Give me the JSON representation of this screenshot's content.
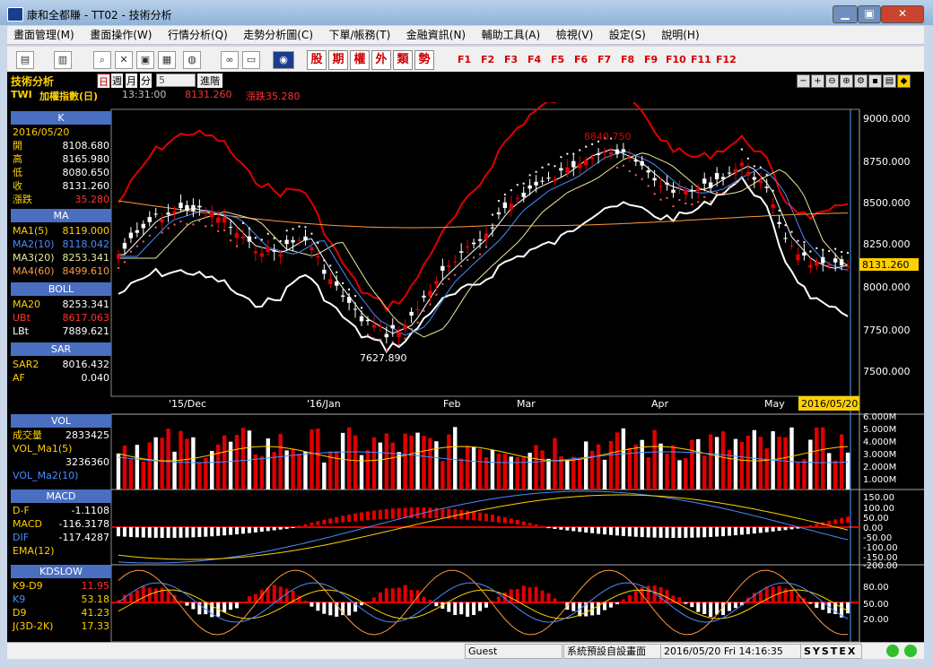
{
  "window": {
    "title": "康和全都賺 - TT02 - 技術分析",
    "minimize": "▁",
    "maximize": "▣",
    "close": "✕"
  },
  "menu": [
    "畫面管理(M)",
    "畫面操作(W)",
    "行情分析(Q)",
    "走勢分析圖(C)",
    "下單/帳務(T)",
    "金融資訊(N)",
    "輔助工具(A)",
    "檢視(V)",
    "設定(S)",
    "說明(H)"
  ],
  "toolbar": {
    "red_buttons": [
      "股",
      "期",
      "權",
      "外",
      "類",
      "勢"
    ],
    "fkeys": [
      "F1",
      "F2",
      "F3",
      "F4",
      "F5",
      "F6",
      "F7",
      "F8",
      "F9",
      "F10",
      "F11",
      "F12"
    ]
  },
  "chart_header": {
    "title": "技術分析",
    "periods": [
      "日",
      "週",
      "月",
      "分"
    ],
    "period_value": "5",
    "advanced": "進階",
    "symbol": "TWI",
    "name": "加權指數(日)",
    "time": "13:31:00",
    "price": "8131.260",
    "change": "漲跌35.280"
  },
  "left_panel": {
    "k": {
      "header": "K",
      "date": "2016/05/20",
      "rows": [
        {
          "label": "開",
          "value": "8108.680"
        },
        {
          "label": "高",
          "value": "8165.980"
        },
        {
          "label": "低",
          "value": "8080.650"
        },
        {
          "label": "收",
          "value": "8131.260"
        },
        {
          "label": "漲跌",
          "value": "35.280"
        }
      ]
    },
    "ma": {
      "header": "MA",
      "rows": [
        {
          "label": "MA1(5)",
          "value": "8119.000"
        },
        {
          "label": "MA2(10)",
          "value": "8118.042"
        },
        {
          "label": "MA3(20)",
          "value": "8253.341"
        },
        {
          "label": "MA4(60)",
          "value": "8499.610"
        }
      ]
    },
    "boll": {
      "header": "BOLL",
      "rows": [
        {
          "label": "MA20",
          "value": "8253.341"
        },
        {
          "label": "UBt",
          "value": "8617.063"
        },
        {
          "label": "LBt",
          "value": "7889.621"
        }
      ]
    },
    "sar": {
      "header": "SAR",
      "rows": [
        {
          "label": "SAR2",
          "value": "8016.432"
        },
        {
          "label": "AF",
          "value": "0.040"
        }
      ]
    },
    "vol": {
      "header": "VOL",
      "rows": [
        {
          "label": "成交量",
          "value": "2833425"
        },
        {
          "label": "VOL_Ma1(5)",
          "value": ""
        },
        {
          "label": "",
          "value": "3236360"
        },
        {
          "label": "VOL_Ma2(10)",
          "value": ""
        }
      ]
    },
    "macd": {
      "header": "MACD",
      "rows": [
        {
          "label": "D-F",
          "value": "-1.1108"
        },
        {
          "label": "MACD",
          "value": "-116.3178"
        },
        {
          "label": "DIF",
          "value": "-117.4287"
        },
        {
          "label": "EMA(12)",
          "value": ""
        }
      ]
    },
    "kd": {
      "header": "KDSLOW",
      "rows": [
        {
          "label": "K9-D9",
          "value": "11.95"
        },
        {
          "label": "K9",
          "value": "53.18"
        },
        {
          "label": "D9",
          "value": "41.23"
        },
        {
          "label": "J(3D-2K)",
          "value": "17.33"
        }
      ]
    }
  },
  "price_axis": [
    "9000.000",
    "8750.000",
    "8500.000",
    "8250.000",
    "8000.000",
    "7750.000",
    "7500.000"
  ],
  "current_price_tag": "8131.260",
  "annotations": {
    "high": "8840.750",
    "low": "7627.890"
  },
  "x_labels": [
    "'15/Dec",
    "'16/Jan",
    "Feb",
    "Mar",
    "Apr",
    "May"
  ],
  "cursor_date": "2016/05/20",
  "vol_axis": [
    "6.000M",
    "5.000M",
    "4.000M",
    "3.000M",
    "2.000M",
    "1.000M"
  ],
  "macd_axis": [
    "150.00",
    "100.00",
    "50.00",
    "0.00",
    "-50.00",
    "-100.00",
    "-150.00",
    "-200.00"
  ],
  "kd_axis": [
    "80.00",
    "50.00",
    "20.00"
  ],
  "statusbar": {
    "user": "Guest",
    "screen": "系統預設自設畫面",
    "datetime": "2016/05/20 Fri 14:16:35",
    "brand": "SYSTEX"
  },
  "colors": {
    "up": "#e00000",
    "down": "#ffffff",
    "boll": "#e00000",
    "ma20": "#ffffff"
  }
}
